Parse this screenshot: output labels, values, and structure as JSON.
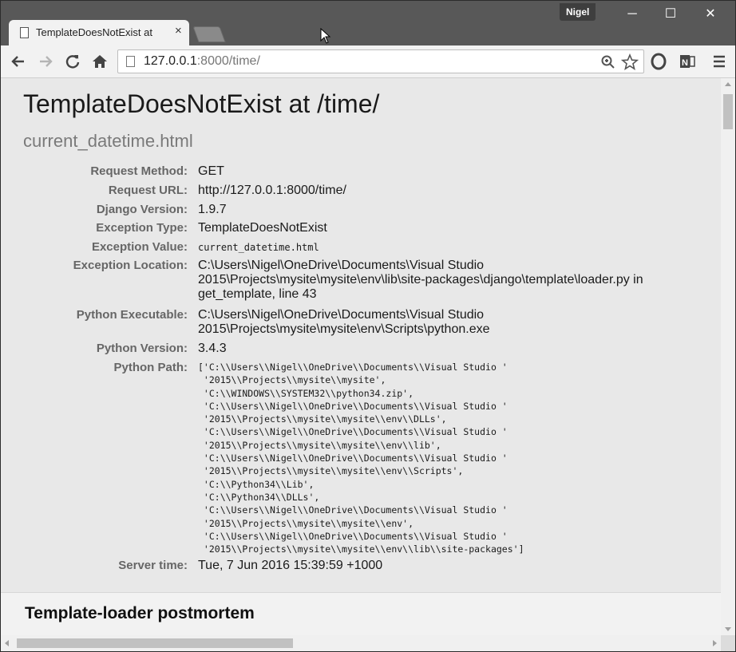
{
  "window": {
    "user": "Nigel",
    "minimize": "─",
    "maximize": "☐",
    "close": "✕"
  },
  "tab": {
    "title": "TemplateDoesNotExist at",
    "close": "×"
  },
  "toolbar": {
    "url_host": "127.0.0.1",
    "url_rest": ":8000/time/",
    "back_icon": "arrow-left-icon",
    "forward_icon": "arrow-right-icon",
    "reload_icon": "reload-icon",
    "home_icon": "home-icon"
  },
  "page": {
    "title": "TemplateDoesNotExist at /time/",
    "subtitle": "current_datetime.html",
    "meta": [
      {
        "key": "Request Method:",
        "value": "GET"
      },
      {
        "key": "Request URL:",
        "value": "http://127.0.0.1:8000/time/"
      },
      {
        "key": "Django Version:",
        "value": "1.9.7"
      },
      {
        "key": "Exception Type:",
        "value": "TemplateDoesNotExist"
      },
      {
        "key": "Exception Value:",
        "value": "current_datetime.html"
      },
      {
        "key": "Exception Location:",
        "value": "C:\\Users\\Nigel\\OneDrive\\Documents\\Visual Studio 2015\\Projects\\mysite\\mysite\\env\\lib\\site-packages\\django\\template\\loader.py in get_template, line 43"
      },
      {
        "key": "Python Executable:",
        "value": "C:\\Users\\Nigel\\OneDrive\\Documents\\Visual Studio 2015\\Projects\\mysite\\mysite\\env\\Scripts\\python.exe"
      },
      {
        "key": "Python Version:",
        "value": "3.4.3"
      },
      {
        "key": "Python Path:",
        "value": ""
      },
      {
        "key": "Server time:",
        "value": "Tue, 7 Jun 2016 15:39:59 +1000"
      }
    ],
    "python_path_lines": [
      "['C:\\\\Users\\\\Nigel\\\\OneDrive\\\\Documents\\\\Visual Studio '",
      " '2015\\\\Projects\\\\mysite\\\\mysite',",
      " 'C:\\\\WINDOWS\\\\SYSTEM32\\\\python34.zip',",
      " 'C:\\\\Users\\\\Nigel\\\\OneDrive\\\\Documents\\\\Visual Studio '",
      " '2015\\\\Projects\\\\mysite\\\\mysite\\\\env\\\\DLLs',",
      " 'C:\\\\Users\\\\Nigel\\\\OneDrive\\\\Documents\\\\Visual Studio '",
      " '2015\\\\Projects\\\\mysite\\\\mysite\\\\env\\\\lib',",
      " 'C:\\\\Users\\\\Nigel\\\\OneDrive\\\\Documents\\\\Visual Studio '",
      " '2015\\\\Projects\\\\mysite\\\\mysite\\\\env\\\\Scripts',",
      " 'C:\\\\Python34\\\\Lib',",
      " 'C:\\\\Python34\\\\DLLs',",
      " 'C:\\\\Users\\\\Nigel\\\\OneDrive\\\\Documents\\\\Visual Studio '",
      " '2015\\\\Projects\\\\mysite\\\\mysite\\\\env',",
      " 'C:\\\\Users\\\\Nigel\\\\OneDrive\\\\Documents\\\\Visual Studio '",
      " '2015\\\\Projects\\\\mysite\\\\mysite\\\\env\\\\lib\\\\site-packages']"
    ],
    "section_heading": "Template-loader postmortem"
  }
}
